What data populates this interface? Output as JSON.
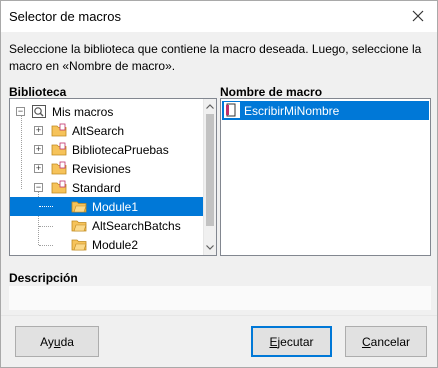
{
  "dialog": {
    "title": "Selector de macros",
    "intro_line1": "Seleccione la biblioteca que contiene la macro deseada. Luego, seleccione la",
    "intro_line2": "macro en «Nombre de macro»."
  },
  "library": {
    "label": "Biblioteca",
    "items": [
      {
        "label": "Mis macros",
        "icon": "my-macros-icon",
        "expander": "minus"
      },
      {
        "label": "AltSearch",
        "icon": "library-folder-icon",
        "expander": "plus"
      },
      {
        "label": "BibliotecaPruebas",
        "icon": "library-folder-icon",
        "expander": "plus"
      },
      {
        "label": "Revisiones",
        "icon": "library-folder-icon",
        "expander": "plus"
      },
      {
        "label": "Standard",
        "icon": "library-folder-icon",
        "expander": "minus"
      },
      {
        "label": "Module1",
        "icon": "module-icon",
        "selected": true
      },
      {
        "label": "AltSearchBatchs",
        "icon": "module-icon"
      },
      {
        "label": "Module2",
        "icon": "module-icon"
      }
    ]
  },
  "macros": {
    "label": "Nombre de macro",
    "items": [
      {
        "label": "EscribirMiNombre",
        "icon": "macro-icon",
        "selected": true
      }
    ]
  },
  "description": {
    "label": "Descripción",
    "value": ""
  },
  "buttons": {
    "help": {
      "pre": "Ay",
      "ul": "u",
      "post": "da"
    },
    "run": {
      "pre": "",
      "ul": "E",
      "post": "jecutar"
    },
    "cancel": {
      "pre": "",
      "ul": "C",
      "post": "ancelar"
    }
  },
  "colors": {
    "selection": "#0078d7",
    "folder": "#f6c35a"
  }
}
